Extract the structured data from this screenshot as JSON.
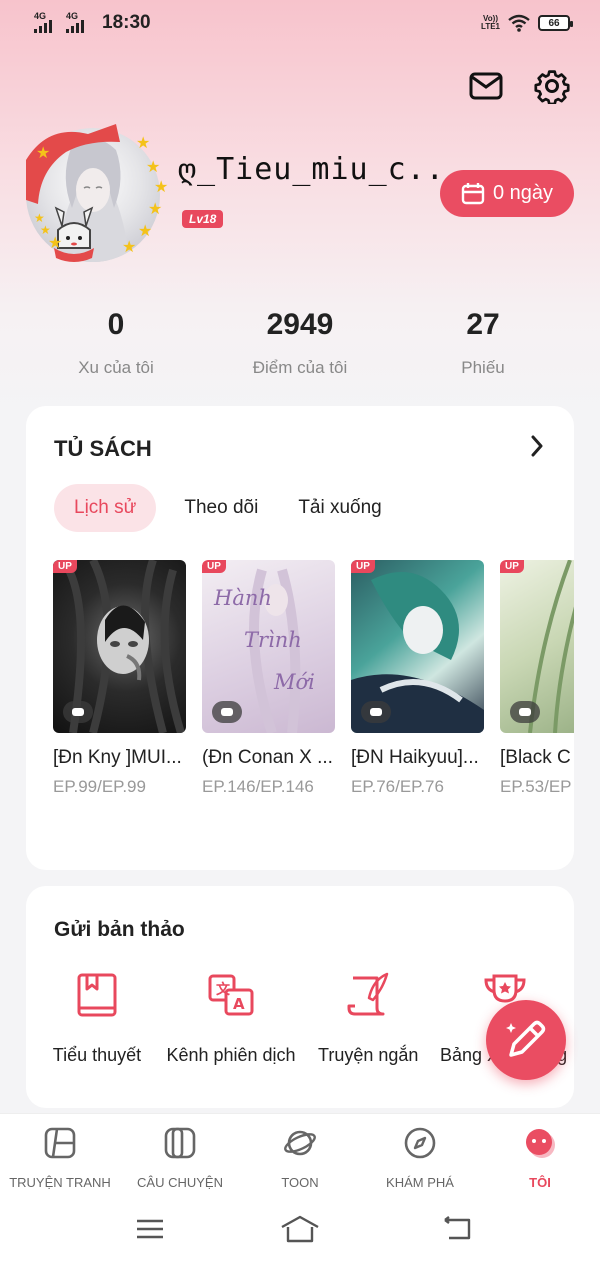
{
  "status_bar": {
    "network1": "4G",
    "network2": "4G",
    "time": "18:30",
    "volte_top": "Vo))",
    "volte_bottom": "LTE1",
    "battery": "66"
  },
  "profile": {
    "username": "ღ_Tieu_miu_c...",
    "level": "Lv18",
    "days_label": "0 ngày"
  },
  "stats": [
    {
      "value": "0",
      "label": "Xu của tôi"
    },
    {
      "value": "2949",
      "label": "Điểm của tôi"
    },
    {
      "value": "27",
      "label": "Phiếu"
    }
  ],
  "bookshelf": {
    "title": "TỦ SÁCH",
    "tabs": [
      {
        "label": "Lịch sử",
        "active": true
      },
      {
        "label": "Theo dõi",
        "active": false
      },
      {
        "label": "Tải xuống",
        "active": false
      }
    ],
    "books": [
      {
        "badge": "UP",
        "title": "[Đn Kny ]MUI...",
        "episodes": "EP.99/EP.99"
      },
      {
        "badge": "UP",
        "title": "(Đn Conan X ...",
        "episodes": "EP.146/EP.146",
        "cover_text": [
          "Hành",
          "Trình",
          "Mới"
        ]
      },
      {
        "badge": "UP",
        "title": "[ĐN Haikyuu]...",
        "episodes": "EP.76/EP.76"
      },
      {
        "badge": "UP",
        "title": "[Black C",
        "episodes": "EP.53/EP"
      }
    ]
  },
  "submit": {
    "title": "Gửi bản thảo",
    "items": [
      {
        "label": "Tiểu thuyết",
        "icon": "book-icon"
      },
      {
        "label": "Kênh phiên dịch",
        "icon": "translate-icon"
      },
      {
        "label": "Truyện ngắn",
        "icon": "scroll-quill-icon"
      },
      {
        "label": "Bảng Xếp Hạng",
        "icon": "trophy-icon"
      }
    ]
  },
  "bottom_nav": [
    {
      "label": "TRUYỆN TRANH",
      "icon": "comic-icon",
      "active": false
    },
    {
      "label": "CÂU CHUYỆN",
      "icon": "books-icon",
      "active": false
    },
    {
      "label": "TOON",
      "icon": "planet-icon",
      "active": false
    },
    {
      "label": "KHÁM PHÁ",
      "icon": "compass-icon",
      "active": false
    },
    {
      "label": "TÔI",
      "icon": "face-icon",
      "active": true
    }
  ],
  "colors": {
    "accent": "#ea4d62",
    "accent_light": "#fbe3e7",
    "header_gradient_top": "#f7c3cc"
  }
}
